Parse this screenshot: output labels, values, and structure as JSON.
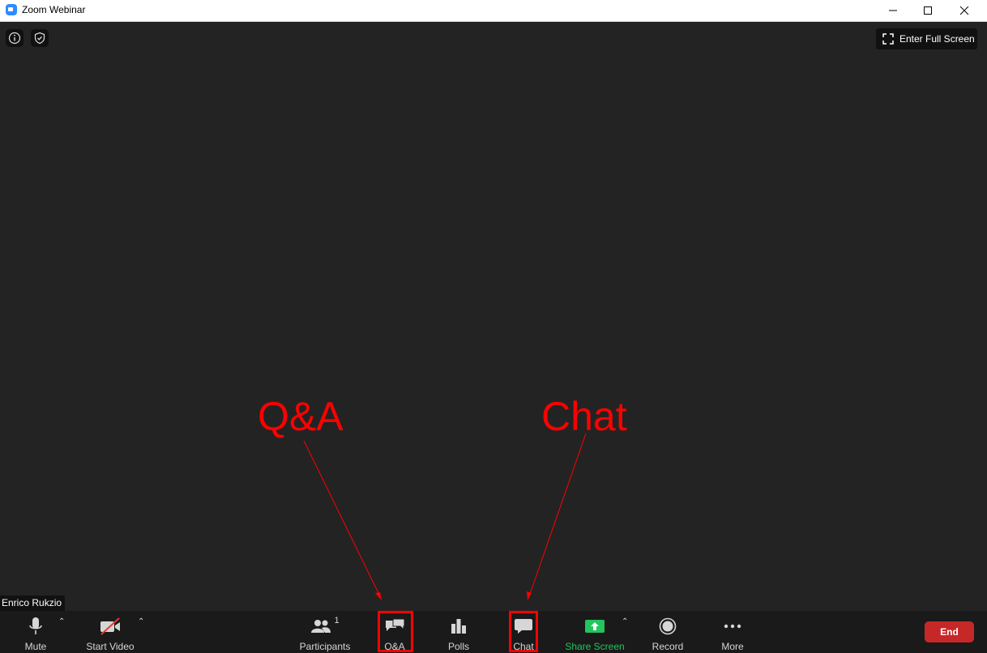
{
  "window": {
    "title": "Zoom Webinar",
    "app_icon": "zoom-icon",
    "controls": [
      "minimize-icon",
      "maximize-icon",
      "close-icon"
    ]
  },
  "top_controls": {
    "info_icon": "info-icon",
    "security_icon": "shield-check-icon",
    "fullscreen_label": "Enter Full Screen"
  },
  "name_tag": "Enrico Rukzio",
  "toolbar": {
    "mute_label": "Mute",
    "start_video_label": "Start Video",
    "participants_label": "Participants",
    "participants_count": "1",
    "qa_label": "Q&A",
    "polls_label": "Polls",
    "chat_label": "Chat",
    "share_screen_label": "Share Screen",
    "record_label": "Record",
    "more_label": "More",
    "end_label": "End"
  },
  "annotations": {
    "qa_text": "Q&A",
    "chat_text": "Chat"
  },
  "colors": {
    "accent_blue": "#2d8cff",
    "share_green": "#22c55e",
    "end_red": "#c62828",
    "annotation_red": "#ff0000",
    "stage_bg": "#232323"
  }
}
